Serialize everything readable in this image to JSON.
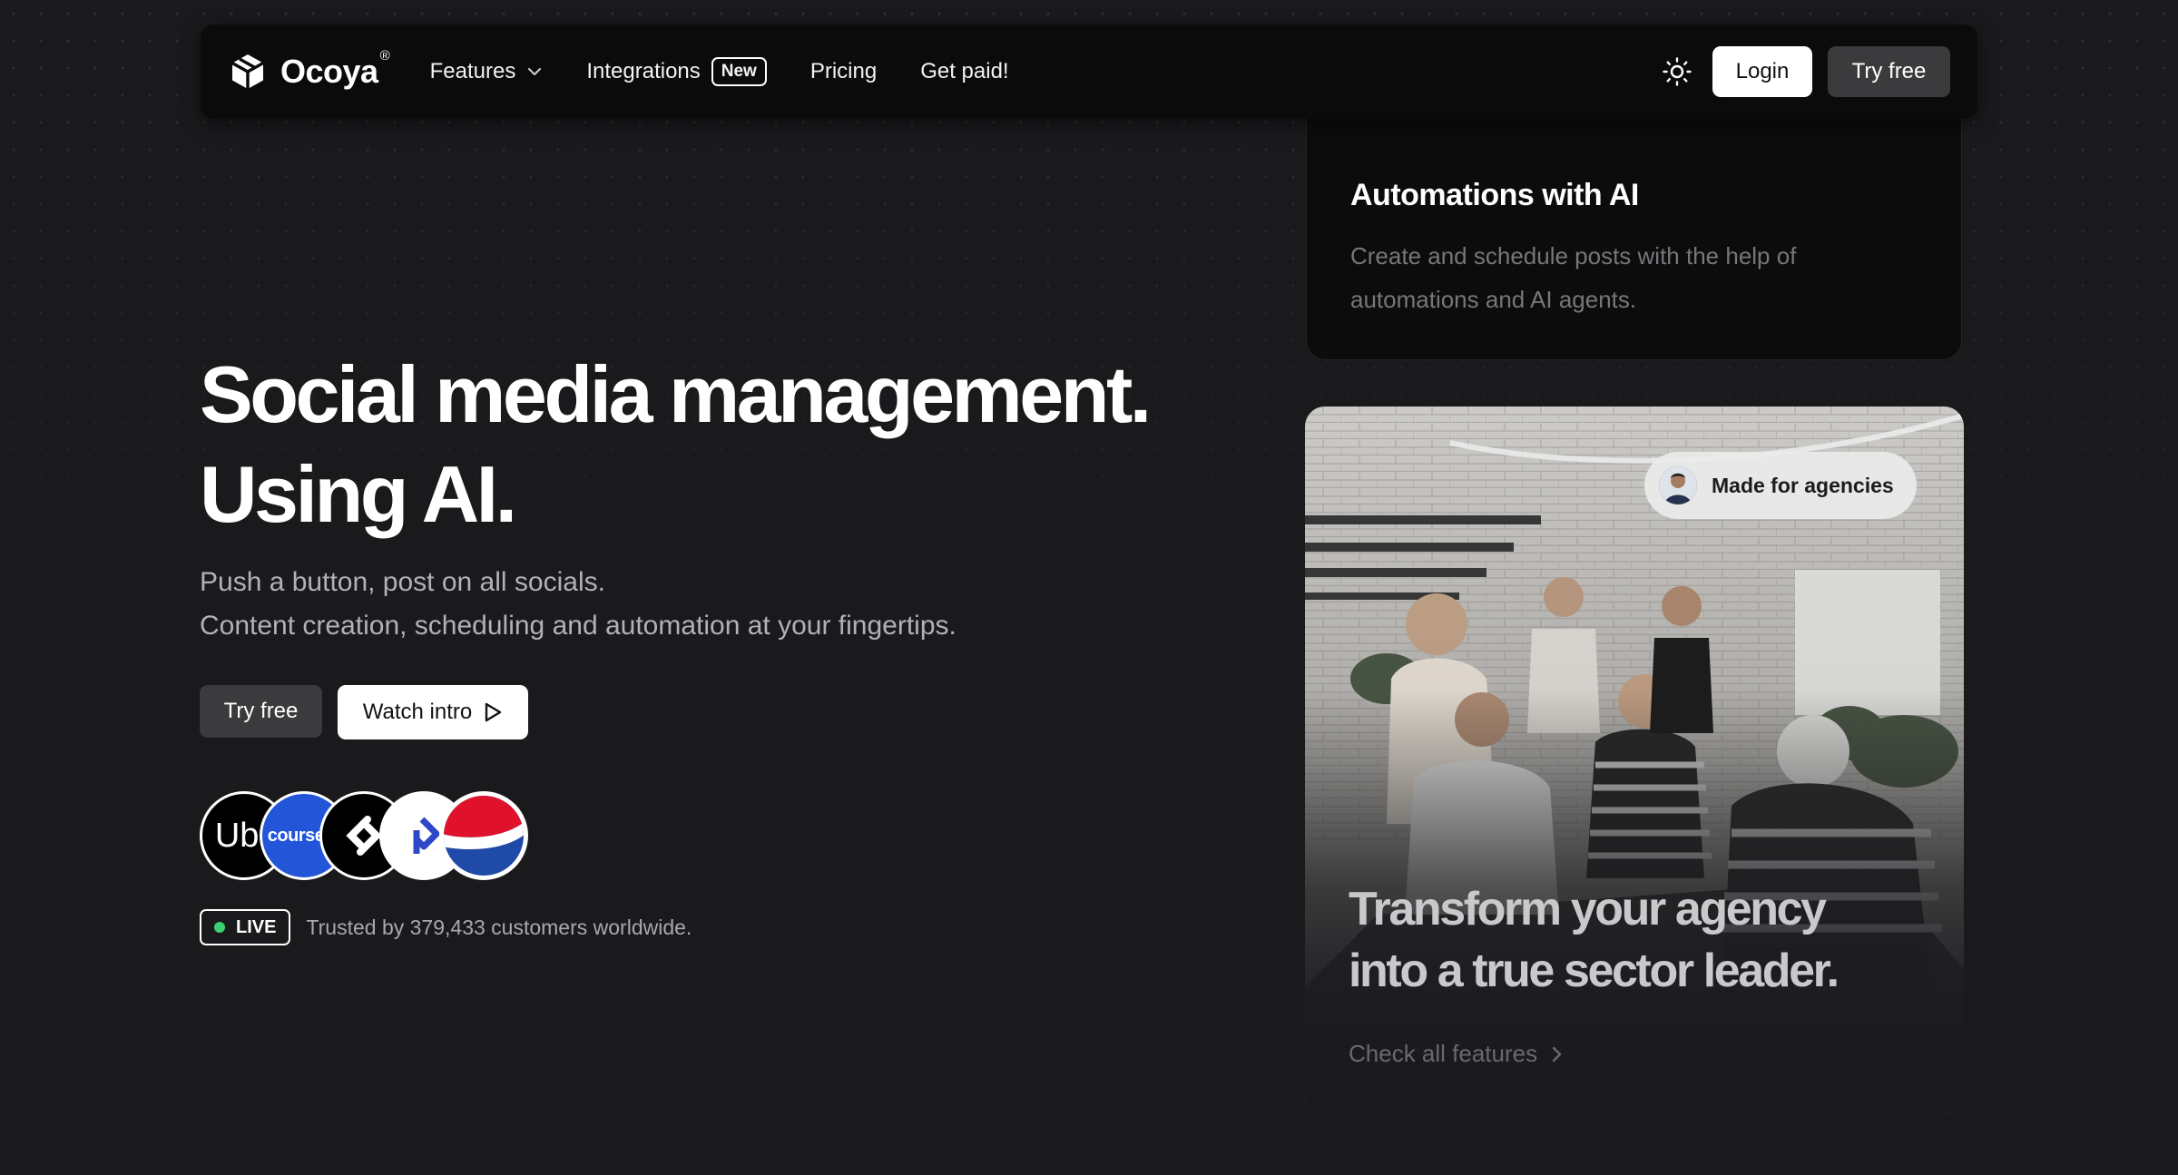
{
  "nav": {
    "brand": "Ocoya",
    "brand_mark": "®",
    "items": [
      {
        "label": "Features"
      },
      {
        "label": "Integrations",
        "badge": "New"
      },
      {
        "label": "Pricing"
      },
      {
        "label": "Get paid!"
      }
    ],
    "login_label": "Login",
    "try_label": "Try free"
  },
  "hero": {
    "title_line1": "Social media management.",
    "title_line2": "Using AI.",
    "sub_line1": "Push a button, post on all socials.",
    "sub_line2": "Content creation, scheduling and automation at your fingertips.",
    "try_label": "Try free",
    "watch_label": "Watch intro"
  },
  "logos": {
    "uber": "Uber",
    "coursera": "coursera"
  },
  "trust": {
    "live_label": "LIVE",
    "text": "Trusted by 379,433 customers worldwide."
  },
  "cards": {
    "automation": {
      "title": "Automations with AI",
      "description": "Create and schedule posts with the help of automations and AI agents."
    },
    "agency": {
      "pill_label": "Made for agencies",
      "headline_line1": "Transform your agency",
      "headline_line2": "into a true sector leader.",
      "link_label": "Check all features"
    }
  },
  "colors": {
    "background": "#1a1a1d",
    "navbar": "#0b0b0c",
    "live_dot": "#3cd070",
    "coursera_blue": "#2255d8",
    "pepsi_blue": "#1f4aa8",
    "pepsi_red": "#e0112b"
  }
}
